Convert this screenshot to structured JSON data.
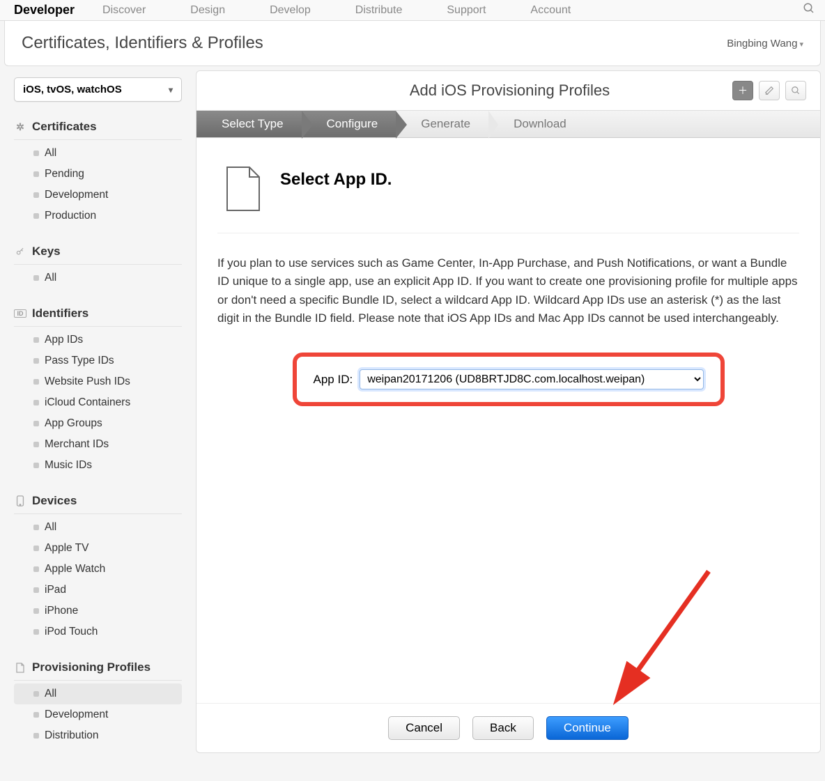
{
  "topnav": {
    "brand": "Developer",
    "links": [
      "Discover",
      "Design",
      "Develop",
      "Distribute",
      "Support",
      "Account"
    ]
  },
  "subheader": {
    "title": "Certificates, Identifiers & Profiles",
    "user": "Bingbing Wang"
  },
  "sidebar": {
    "platform": "iOS, tvOS, watchOS",
    "groups": [
      {
        "icon": "gear",
        "title": "Certificates",
        "items": [
          "All",
          "Pending",
          "Development",
          "Production"
        ]
      },
      {
        "icon": "key",
        "title": "Keys",
        "items": [
          "All"
        ]
      },
      {
        "icon": "id",
        "title": "Identifiers",
        "items": [
          "App IDs",
          "Pass Type IDs",
          "Website Push IDs",
          "iCloud Containers",
          "App Groups",
          "Merchant IDs",
          "Music IDs"
        ]
      },
      {
        "icon": "device",
        "title": "Devices",
        "items": [
          "All",
          "Apple TV",
          "Apple Watch",
          "iPad",
          "iPhone",
          "iPod Touch"
        ]
      },
      {
        "icon": "file",
        "title": "Provisioning Profiles",
        "items": [
          "All",
          "Development",
          "Distribution"
        ],
        "selected": "All"
      }
    ]
  },
  "main": {
    "title": "Add iOS Provisioning Profiles",
    "steps": [
      "Select Type",
      "Configure",
      "Generate",
      "Download"
    ],
    "active_steps": [
      0,
      1
    ],
    "heading": "Select App ID.",
    "description": "If you plan to use services such as Game Center, In-App Purchase, and Push Notifications, or want a Bundle ID unique to a single app, use an explicit App ID. If you want to create one provisioning profile for multiple apps or don't need a specific Bundle ID, select a wildcard App ID. Wildcard App IDs use an asterisk (*) as the last digit in the Bundle ID field. Please note that iOS App IDs and Mac App IDs cannot be used interchangeably.",
    "appid_label": "App ID:",
    "appid_value": "weipan20171206 (UD8BRTJD8C.com.localhost.weipan)",
    "buttons": {
      "cancel": "Cancel",
      "back": "Back",
      "continue": "Continue"
    }
  }
}
